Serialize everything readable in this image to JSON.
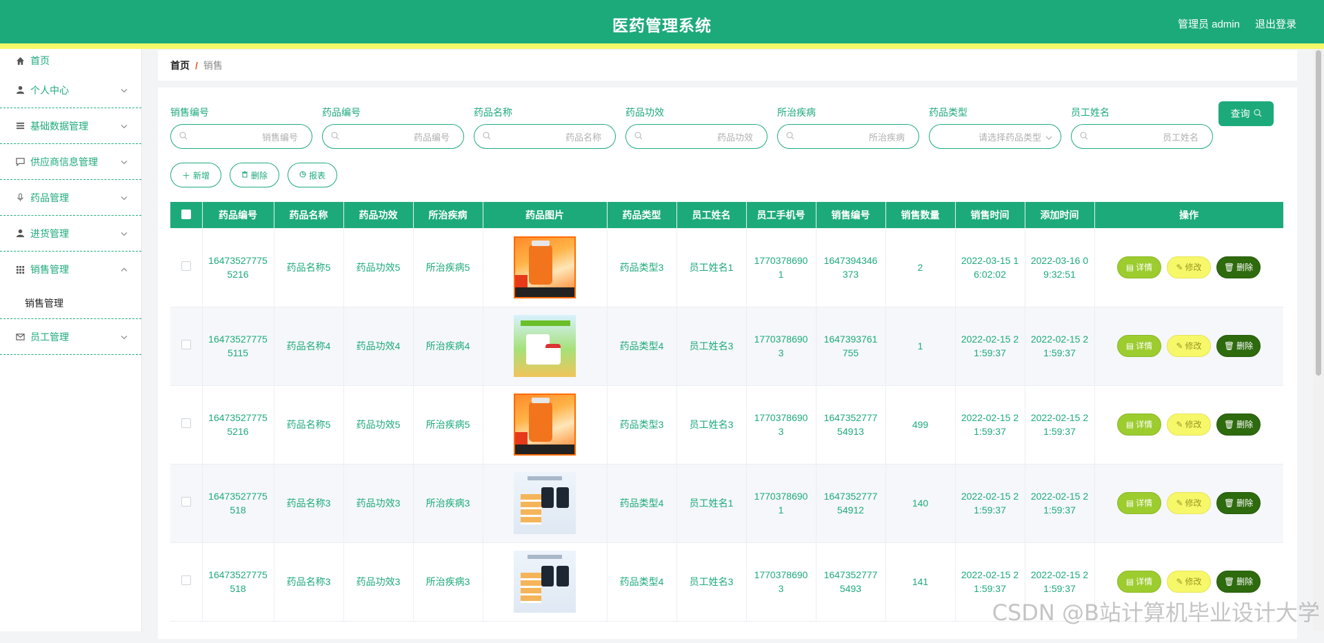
{
  "header": {
    "title": "医药管理系统",
    "user": "管理员 admin",
    "logout": "退出登录"
  },
  "sidebar": {
    "items": [
      {
        "label": "首页",
        "icon": "home-icon"
      },
      {
        "label": "个人中心",
        "icon": "user-icon"
      },
      {
        "label": "基础数据管理",
        "icon": "list-icon"
      },
      {
        "label": "供应商信息管理",
        "icon": "chat-icon"
      },
      {
        "label": "药品管理",
        "icon": "mic-icon"
      },
      {
        "label": "进货管理",
        "icon": "user-icon"
      },
      {
        "label": "销售管理",
        "icon": "grid-icon"
      },
      {
        "label": "员工管理",
        "icon": "mail-icon"
      }
    ],
    "submenu": "销售管理"
  },
  "breadcrumb": {
    "home": "首页",
    "sep": "/",
    "current": "销售"
  },
  "filters": [
    {
      "label": "销售编号",
      "placeholder": "销售编号"
    },
    {
      "label": "药品编号",
      "placeholder": "药品编号"
    },
    {
      "label": "药品名称",
      "placeholder": "药品名称"
    },
    {
      "label": "药品功效",
      "placeholder": "药品功效"
    },
    {
      "label": "所治疾病",
      "placeholder": "所治疾病"
    },
    {
      "label": "药品类型",
      "placeholder": "请选择药品类型"
    },
    {
      "label": "员工姓名",
      "placeholder": "员工姓名"
    }
  ],
  "query_label": "查询",
  "actions": {
    "add": "新增",
    "delete": "删除",
    "report": "报表"
  },
  "table": {
    "columns": [
      "药品编号",
      "药品名称",
      "药品功效",
      "所治疾病",
      "药品图片",
      "药品类型",
      "员工姓名",
      "员工手机号",
      "销售编号",
      "销售数量",
      "销售时间",
      "添加时间",
      "操作"
    ],
    "rows": [
      {
        "drug_no": "164735277755216",
        "name": "药品名称5",
        "effect": "药品功效5",
        "disease": "所治疾病5",
        "image": "orange",
        "type": "药品类型3",
        "staff": "员工姓名1",
        "phone": "17703786901",
        "sale_no": "1647394346373",
        "qty": "2",
        "sale_time": "2022-03-15 16:02:02",
        "add_time": "2022-03-16 09:32:51"
      },
      {
        "drug_no": "164735277755115",
        "name": "药品名称4",
        "effect": "药品功效4",
        "disease": "所治疾病4",
        "image": "green",
        "type": "药品类型4",
        "staff": "员工姓名3",
        "phone": "17703786903",
        "sale_no": "1647393761755",
        "qty": "1",
        "sale_time": "2022-02-15 21:59:37",
        "add_time": "2022-02-15 21:59:37"
      },
      {
        "drug_no": "164735277755216",
        "name": "药品名称5",
        "effect": "药品功效5",
        "disease": "所治疾病5",
        "image": "orange",
        "type": "药品类型3",
        "staff": "员工姓名3",
        "phone": "17703786903",
        "sale_no": "164735277754913",
        "qty": "499",
        "sale_time": "2022-02-15 21:59:37",
        "add_time": "2022-02-15 21:59:37"
      },
      {
        "drug_no": "16473527775518",
        "name": "药品名称3",
        "effect": "药品功效3",
        "disease": "所治疾病3",
        "image": "blue",
        "type": "药品类型4",
        "staff": "员工姓名1",
        "phone": "17703786901",
        "sale_no": "164735277754912",
        "qty": "140",
        "sale_time": "2022-02-15 21:59:37",
        "add_time": "2022-02-15 21:59:37"
      },
      {
        "drug_no": "16473527775518",
        "name": "药品名称3",
        "effect": "药品功效3",
        "disease": "所治疾病3",
        "image": "blue",
        "type": "药品类型4",
        "staff": "员工姓名3",
        "phone": "17703786903",
        "sale_no": "16473527775493",
        "qty": "141",
        "sale_time": "2022-02-15 21:59:37",
        "add_time": "2022-02-15 21:59:37"
      }
    ],
    "ops": {
      "detail": "详情",
      "edit": "修改",
      "delete": "删除"
    }
  },
  "watermark": "CSDN @B站计算机毕业设计大学",
  "colors": {
    "primary": "#1daa7a",
    "stripe": "#f7f76a",
    "detail": "#9ccc2e",
    "edit": "#f7f76a",
    "delete": "#2e6a0e"
  }
}
